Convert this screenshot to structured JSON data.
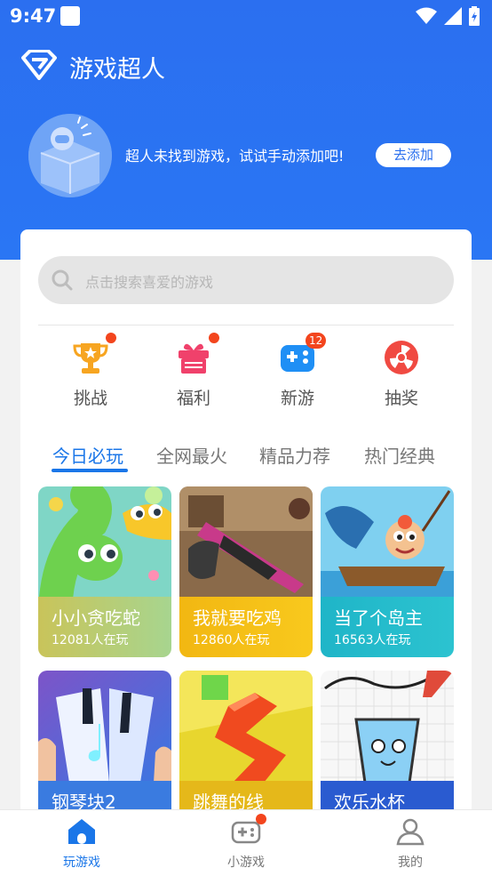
{
  "status_bar": {
    "time": "9:47"
  },
  "header": {
    "title": "游戏超人"
  },
  "empty_state": {
    "message": "超人未找到游戏，试试手动添加吧!",
    "add_button": "去添加"
  },
  "search": {
    "placeholder": "点击搜索喜爱的游戏"
  },
  "quick_actions": [
    {
      "label": "挑战",
      "icon": "trophy-icon",
      "badge": "dot"
    },
    {
      "label": "福利",
      "icon": "gift-icon",
      "badge": "dot"
    },
    {
      "label": "新游",
      "icon": "gamepad-icon",
      "badge": "12"
    },
    {
      "label": "抽奖",
      "icon": "lottery-wheel-icon",
      "badge": ""
    }
  ],
  "tabs": [
    {
      "label": "今日必玩",
      "active": true
    },
    {
      "label": "全网最火",
      "active": false
    },
    {
      "label": "精品力荐",
      "active": false
    },
    {
      "label": "热门经典",
      "active": false
    }
  ],
  "games": [
    {
      "name": "小小贪吃蛇",
      "players": "12081人在玩"
    },
    {
      "name": "我就要吃鸡",
      "players": "12860人在玩"
    },
    {
      "name": "当了个岛主",
      "players": "16563人在玩"
    },
    {
      "name": "钢琴块2",
      "players": ""
    },
    {
      "name": "跳舞的线",
      "players": ""
    },
    {
      "name": "欢乐水杯",
      "players": ""
    }
  ],
  "bottom_nav": [
    {
      "label": "玩游戏",
      "active": true
    },
    {
      "label": "小游戏",
      "active": false
    },
    {
      "label": "我的",
      "active": false
    }
  ],
  "colors": {
    "primary": "#2a6fee",
    "accent": "#1a76e8",
    "badge": "#f3451d"
  }
}
